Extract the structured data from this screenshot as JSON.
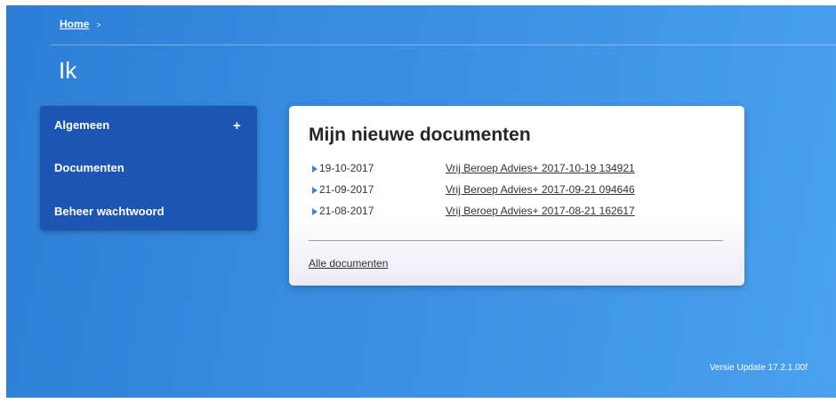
{
  "breadcrumb": {
    "home_label": "Home",
    "separator": ">"
  },
  "page": {
    "title": "Ik"
  },
  "sidebar": {
    "expand_symbol": "+",
    "items": [
      {
        "label": "Algemeen"
      },
      {
        "label": "Documenten"
      },
      {
        "label": "Beheer wachtwoord"
      }
    ]
  },
  "card": {
    "title": "Mijn nieuwe documenten",
    "documents": [
      {
        "date": "19-10-2017",
        "name": "Vrij Beroep Advies+ 2017-10-19 134921"
      },
      {
        "date": "21-09-2017",
        "name": "Vrij Beroep Advies+ 2017-09-21 094646"
      },
      {
        "date": "21-08-2017",
        "name": "Vrij Beroep Advies+ 2017-08-21 162617"
      }
    ],
    "all_link": "Alle documenten"
  },
  "footer": {
    "version": "Versie Update 17.2.1.00f"
  },
  "colors": {
    "background": "#3a8ee3",
    "sidebar": "#1c55b3",
    "bullet": "#3a86d8"
  }
}
